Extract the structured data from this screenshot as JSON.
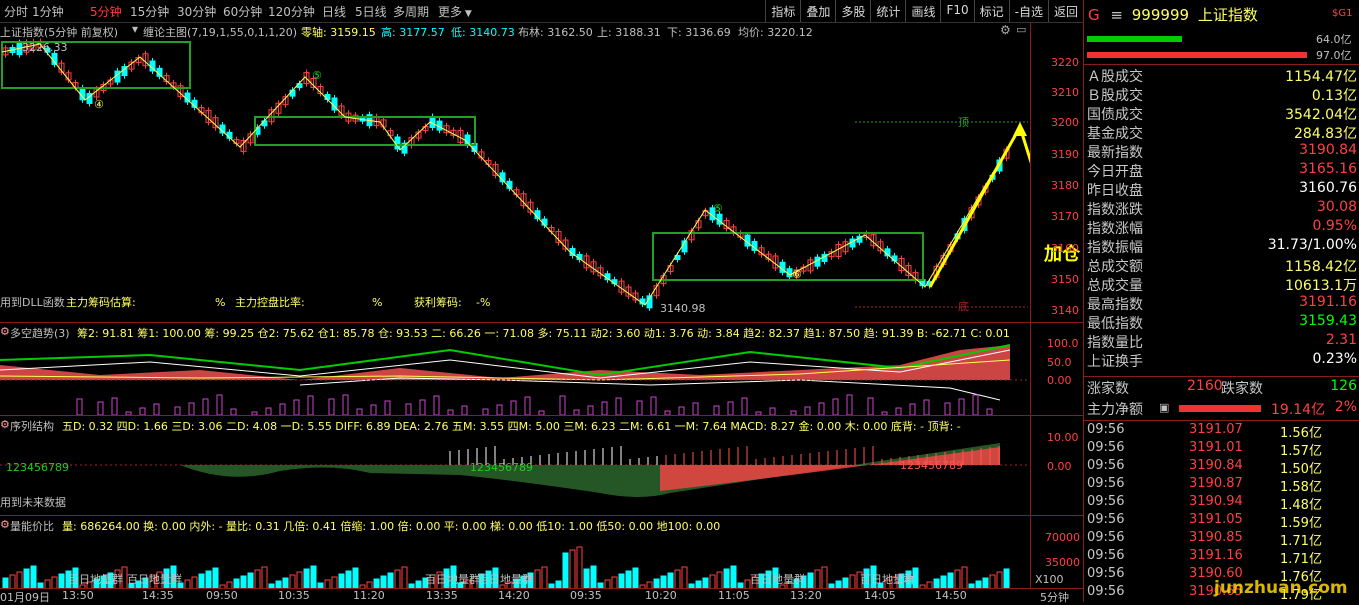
{
  "toolbar": {
    "timeframes": [
      "分时",
      "1分钟",
      "5分钟",
      "15分钟",
      "30分钟",
      "60分钟",
      "120分钟",
      "日线",
      "5日线",
      "多周期",
      "更多"
    ],
    "active_timeframe": "5分钟",
    "tools": [
      "指标",
      "叠加",
      "多股",
      "统计",
      "画线",
      "F10",
      "标记",
      "-自选",
      "返回"
    ]
  },
  "main_chart": {
    "title": "上证指数(5分钟 前复权)",
    "indicator_label": "缠论主图(7,19,1,55,0,1,1,20)",
    "zero_axis": "零轴: 3159.15",
    "high": "高: 3177.57",
    "low": "低: 3140.73",
    "boll": "布林: 3162.50",
    "upper": "上: 3188.31",
    "lower": "下: 3136.69",
    "avg": "均价: 3220.12",
    "peak_label": "3226.33",
    "trough_label": "3140.98",
    "add_label": "加仓",
    "top_label": "顶",
    "bottom_label": "底",
    "dll_text": "用到DLL函数",
    "est_text": "主力筹码估算:",
    "ctrl_text": "主力控盘比率:",
    "profit_text": "获利筹码:",
    "pct1": "%",
    "pct2": "%",
    "pct3": "-%",
    "circle_labels": [
      "④",
      "⑤",
      "⑥",
      "⑤",
      "⑥"
    ],
    "yaxis": [
      "3220",
      "3210",
      "3200",
      "3190",
      "3180",
      "3170",
      "3160",
      "3150",
      "3140"
    ]
  },
  "panel2": {
    "label": "多空趋势(3)",
    "values": "筹2: 91.81  筹1: 100.00  筹: 99.25  仓2: 75.62  仓1: 85.78  仓: 93.53  二: 66.26  一: 71.08  多: 75.11  动2: 3.60  动1: 3.76  动: 3.84  趋2: 82.37  趋1: 87.50  趋: 91.39  B: -62.71  C: 0.01",
    "yaxis": [
      "100.0",
      "50.0",
      "0.00"
    ]
  },
  "panel3": {
    "label": "序列结构",
    "values": "五D: 0.32  四D: 1.66  三D: 3.06  二D: 4.08  一D: 5.55  DIFF: 6.89  DEA: 2.76  五M: 3.55  四M: 5.00  三M: 6.23  二M: 6.61  一M: 7.64  MACD: 8.27  金: 0.00  木: 0.00  底背: -  顶背: -",
    "future_text": "用到未来数据",
    "seq_text": "123456789",
    "yaxis": [
      "10.00",
      "0.00"
    ]
  },
  "panel4": {
    "label": "量能价比",
    "values": "量: 686264.00  换: 0.00  内外: - 量比: 0.31  几倍: 0.41  倍缩: 1.00  倍: 0.00  平: 0.00  梯: 0.00  低10: 1.00  低50: 0.00  地100: 0.00",
    "ground_text": "百日地量群",
    "yaxis": [
      "70000",
      "35000",
      "X100"
    ]
  },
  "time_axis": [
    "01月09日",
    "13:50",
    "14:35",
    "09:50",
    "10:35",
    "11:20",
    "13:35",
    "14:20",
    "09:35",
    "10:20",
    "11:05",
    "13:20",
    "14:05",
    "14:50"
  ],
  "period_label": "5分钟",
  "right_panel": {
    "code": "999999",
    "name": "上证指数",
    "flag": "$G1",
    "bar1": "64.0亿",
    "bar2": "97.0亿",
    "rows": [
      {
        "k": "Ａ股成交",
        "v": "1154.47亿",
        "c": "#ffff66"
      },
      {
        "k": "Ｂ股成交",
        "v": "0.13亿",
        "c": "#ffff66"
      },
      {
        "k": "国债成交",
        "v": "3542.04亿",
        "c": "#ffff66"
      },
      {
        "k": "基金成交",
        "v": "284.83亿",
        "c": "#ffff66"
      },
      {
        "k": "最新指数",
        "v": "3190.84",
        "c": "#ff4040"
      },
      {
        "k": "今日开盘",
        "v": "3165.16",
        "c": "#ff4040"
      },
      {
        "k": "昨日收盘",
        "v": "3160.76",
        "c": "#ffffff"
      },
      {
        "k": "指数涨跌",
        "v": "30.08",
        "c": "#ff4040"
      },
      {
        "k": "指数涨幅",
        "v": "0.95%",
        "c": "#ff4040"
      },
      {
        "k": "指数振幅",
        "v": "31.73/1.00%",
        "c": "#ffffff"
      },
      {
        "k": "总成交额",
        "v": "1158.42亿",
        "c": "#ffff66"
      },
      {
        "k": "总成交量",
        "v": "10613.1万",
        "c": "#ffff66"
      },
      {
        "k": "最高指数",
        "v": "3191.16",
        "c": "#ff4040"
      },
      {
        "k": "最低指数",
        "v": "3159.43",
        "c": "#00ff00"
      },
      {
        "k": "指数量比",
        "v": "2.31",
        "c": "#ff4040"
      },
      {
        "k": "上证换手",
        "v": "0.23%",
        "c": "#ffffff"
      }
    ],
    "up_label": "涨家数",
    "up_value": "2160",
    "down_label": "跌家数",
    "down_value": "126",
    "net_label": "主力净额",
    "net_value": "19.14亿",
    "net_pct": "2%",
    "ticks": [
      {
        "t": "09:56",
        "p": "3191.07",
        "a": "1.56亿"
      },
      {
        "t": "09:56",
        "p": "3191.01",
        "a": "1.57亿"
      },
      {
        "t": "09:56",
        "p": "3190.84",
        "a": "1.50亿"
      },
      {
        "t": "09:56",
        "p": "3190.87",
        "a": "1.58亿"
      },
      {
        "t": "09:56",
        "p": "3190.94",
        "a": "1.48亿"
      },
      {
        "t": "09:56",
        "p": "3191.05",
        "a": "1.59亿"
      },
      {
        "t": "09:56",
        "p": "3190.85",
        "a": "1.71亿"
      },
      {
        "t": "09:56",
        "p": "3191.16",
        "a": "1.71亿"
      },
      {
        "t": "09:56",
        "p": "3190.60",
        "a": "1.76亿"
      },
      {
        "t": "09:56",
        "p": "3190.65",
        "a": "1.79亿"
      }
    ],
    "watermark": "junzhuan.com"
  }
}
